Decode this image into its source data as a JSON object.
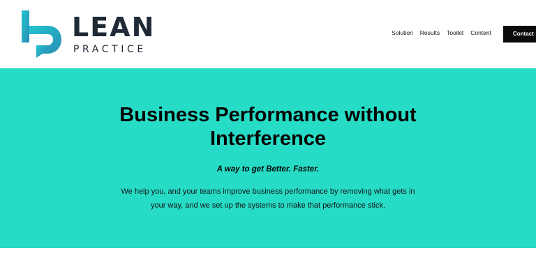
{
  "logo": {
    "word": "LEAN",
    "sub": "PRACTICE",
    "mark_icon": "lp-monogram",
    "mark_color": "#2bb3c5",
    "word_color": "#1f2a36"
  },
  "nav": {
    "items": [
      {
        "label": "Solution"
      },
      {
        "label": "Results"
      },
      {
        "label": "Toolkit"
      },
      {
        "label": "Content"
      }
    ],
    "contact_label": "Contact"
  },
  "hero": {
    "background": "#27dcc6",
    "title_line1": "Business Performance without",
    "title_line2": "Interference",
    "tagline": "A way to get Better. Faster.",
    "body_line1": "We help you, and your teams improve business performance by removing what gets in",
    "body_line2": "your way, and we set up the systems to make that performance stick."
  }
}
